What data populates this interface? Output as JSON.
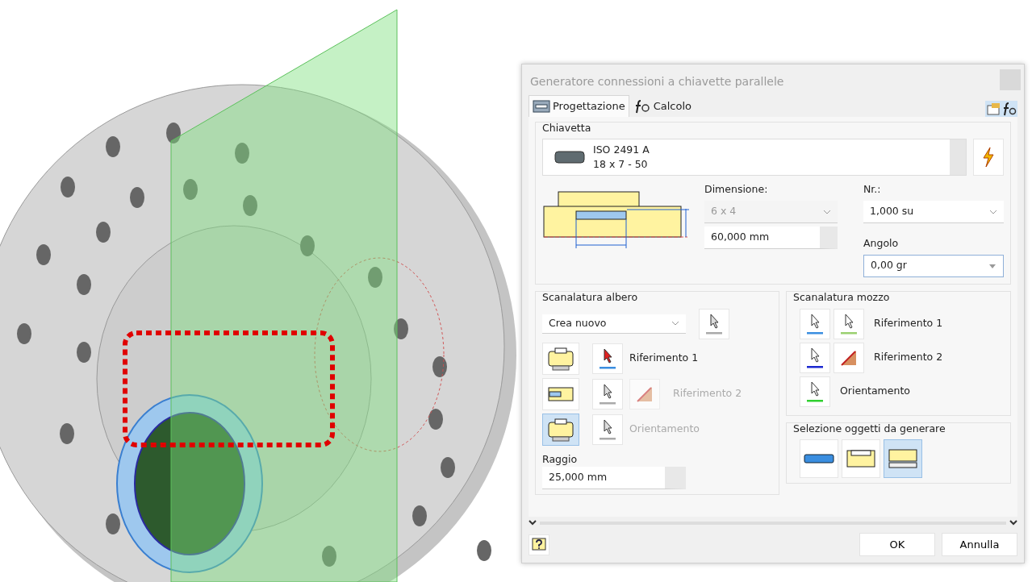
{
  "dialog": {
    "title": "Generatore connessioni a chiavette parallele",
    "tabs": [
      {
        "label": "Progettazione",
        "selected": true
      },
      {
        "label": "Calcolo",
        "selected": false
      }
    ],
    "key": {
      "section": "Chiavetta",
      "standard": "ISO 2491 A",
      "size": "18 x 7 - 50"
    },
    "dimension": {
      "label": "Dimensione:",
      "value": "6 x 4",
      "disabled": true
    },
    "length": {
      "value": "60,000 mm"
    },
    "count": {
      "label": "Nr.:",
      "value": "1,000 su"
    },
    "angle": {
      "label": "Angolo",
      "value": "0,00 gr"
    },
    "shaft_groove": {
      "title": "Scanalatura albero",
      "mode": "Crea nuovo",
      "shapes": [
        {
          "selected": false
        },
        {
          "selected": false
        },
        {
          "selected": true
        }
      ],
      "references": [
        {
          "label": "Riferimento 1",
          "disabled": false
        },
        {
          "label": "Riferimento 2",
          "disabled": true
        },
        {
          "label": "Orientamento",
          "disabled": true
        }
      ],
      "radius_label": "Raggio",
      "radius": "25,000 mm"
    },
    "hub_groove": {
      "title": "Scanalatura mozzo",
      "references": [
        {
          "label": "Riferimento 1",
          "disabled": false
        },
        {
          "label": "Riferimento 2",
          "disabled": false
        },
        {
          "label": "Orientamento",
          "disabled": false
        }
      ]
    },
    "generate": {
      "title": "Selezione oggetti da generare",
      "options": [
        {
          "selected": false
        },
        {
          "selected": false
        },
        {
          "selected": true
        }
      ]
    },
    "buttons": [
      {
        "label": "OK"
      },
      {
        "label": "Annulla"
      }
    ]
  }
}
